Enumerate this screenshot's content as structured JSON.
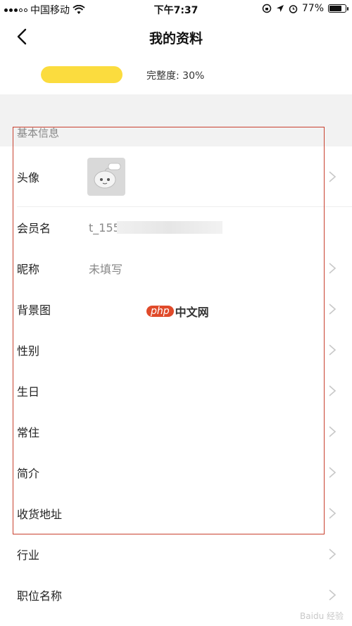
{
  "status_bar": {
    "carrier": "中国移动",
    "time": "下午7:37",
    "battery": "77%",
    "battery_level": 0.77,
    "icons": [
      "signal-dots-icon",
      "wifi-icon",
      "orientation-lock-icon",
      "location-icon",
      "alarm-icon",
      "battery-icon"
    ]
  },
  "navbar": {
    "title": "我的资料",
    "back_icon": "chevron-left-icon"
  },
  "progress": {
    "percent": 30,
    "label": "完整度: 30%",
    "color": "#fbdc3e"
  },
  "section": {
    "title": "基本信息"
  },
  "profile": {
    "avatar_label": "头像",
    "member_name_label": "会员名",
    "member_name_value": "t_155",
    "nickname_label": "昵称",
    "nickname_value": "未填写",
    "background_label": "背景图",
    "gender_label": "性别",
    "birthday_label": "生日",
    "residence_label": "常住",
    "bio_label": "简介",
    "address_label": "收货地址",
    "industry_label": "行业",
    "job_title_label": "职位名称"
  },
  "watermark": {
    "badge": "php",
    "text": "中文网",
    "footer": "Baidu 经验"
  },
  "colors": {
    "accent": "#fbdc3e",
    "highlight_border": "#c8402e",
    "label_gray": "#888888"
  }
}
